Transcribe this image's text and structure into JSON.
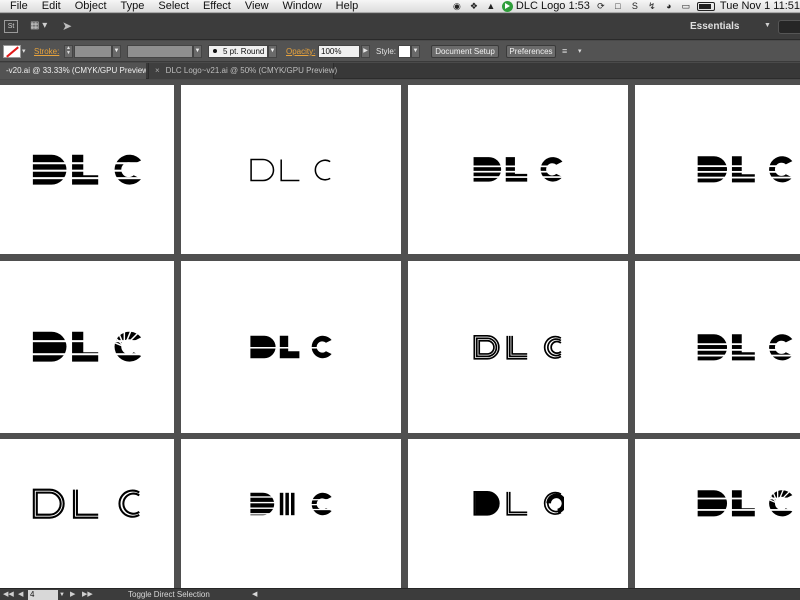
{
  "menubar": {
    "items": [
      "File",
      "Edit",
      "Object",
      "Type",
      "Select",
      "Effect",
      "View",
      "Window",
      "Help"
    ],
    "timer_label": "DLC Logo 1:53",
    "clock": "Tue Nov 1  11:51"
  },
  "appbar": {
    "app_logo": "St",
    "workspace": "Essentials",
    "icons": [
      "arrange-documents-icon",
      "send-to-icon"
    ]
  },
  "controlbar": {
    "stroke_label": "Stroke:",
    "brush_label": "5 pt. Round",
    "opacity_label": "Opacity:",
    "opacity_value": "100%",
    "style_label": "Style:",
    "document_setup_label": "Document Setup",
    "preferences_label": "Preferences"
  },
  "tabs": [
    {
      "label": "-v20.ai @ 33.33% (CMYK/GPU Preview)",
      "active": true
    },
    {
      "label": "DLC Logo~v21.ai @ 50% (CMYK/GPU Preview)",
      "active": false,
      "close_glyph": "×"
    }
  ],
  "artboards": [
    {
      "logo_text": "DLC",
      "style": "pixel-stencil"
    },
    {
      "logo_text": "DLC",
      "style": "outline-spiral"
    },
    {
      "logo_text": "DLC",
      "style": "sliced-bold"
    },
    {
      "logo_text": "DLC",
      "style": "sliced-bold"
    },
    {
      "logo_text": "DLC",
      "style": "sunburst"
    },
    {
      "logo_text": "DLC",
      "style": "cut-bold"
    },
    {
      "logo_text": "DLC",
      "style": "triple-line"
    },
    {
      "logo_text": "DLC",
      "style": "wave-stripe"
    },
    {
      "logo_text": "DLC",
      "style": "double-outline"
    },
    {
      "logo_text": "DLC",
      "style": "bars"
    },
    {
      "logo_text": "DLC",
      "style": "inline-stripe"
    },
    {
      "logo_text": "DLC",
      "style": "star-burst"
    }
  ],
  "statusbar": {
    "zoom_value": "4",
    "tool_status": "Toggle Direct Selection"
  },
  "colors": {
    "canvas": "#4f4f4f",
    "artboard": "#ffffff",
    "accent_orange": "#e8a33c",
    "logo": "#000000"
  }
}
